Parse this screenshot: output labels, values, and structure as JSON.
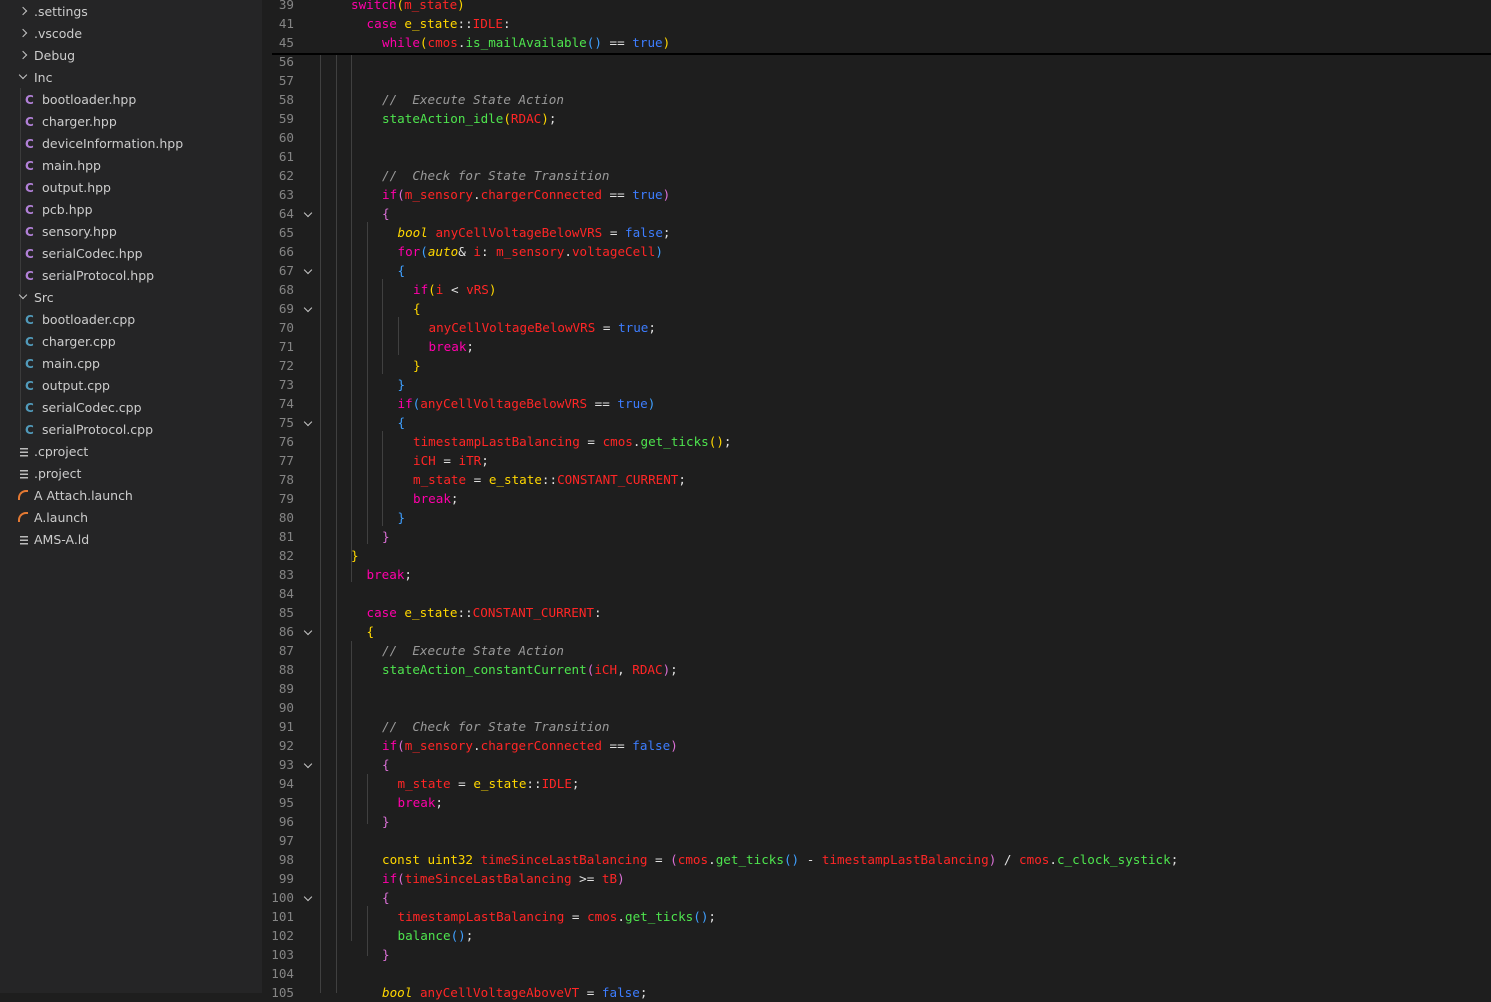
{
  "explorer": {
    "items": [
      {
        "label": ".settings",
        "kind": "folder-closed"
      },
      {
        "label": ".vscode",
        "kind": "folder-closed"
      },
      {
        "label": "Debug",
        "kind": "folder-closed"
      },
      {
        "label": "Inc",
        "kind": "folder-open"
      },
      {
        "label": "bootloader.hpp",
        "kind": "hpp"
      },
      {
        "label": "charger.hpp",
        "kind": "hpp"
      },
      {
        "label": "deviceInformation.hpp",
        "kind": "hpp"
      },
      {
        "label": "main.hpp",
        "kind": "hpp"
      },
      {
        "label": "output.hpp",
        "kind": "hpp"
      },
      {
        "label": "pcb.hpp",
        "kind": "hpp"
      },
      {
        "label": "sensory.hpp",
        "kind": "hpp"
      },
      {
        "label": "serialCodec.hpp",
        "kind": "hpp"
      },
      {
        "label": "serialProtocol.hpp",
        "kind": "hpp"
      },
      {
        "label": "Src",
        "kind": "folder-open"
      },
      {
        "label": "bootloader.cpp",
        "kind": "cpp"
      },
      {
        "label": "charger.cpp",
        "kind": "cpp"
      },
      {
        "label": "main.cpp",
        "kind": "cpp"
      },
      {
        "label": "output.cpp",
        "kind": "cpp"
      },
      {
        "label": "serialCodec.cpp",
        "kind": "cpp"
      },
      {
        "label": "serialProtocol.cpp",
        "kind": "cpp"
      },
      {
        "label": ".cproject",
        "kind": "text"
      },
      {
        "label": ".project",
        "kind": "text"
      },
      {
        "label": "A Attach.launch",
        "kind": "launch"
      },
      {
        "label": "A.launch",
        "kind": "launch"
      },
      {
        "label": "AMS-A.ld",
        "kind": "text"
      }
    ]
  },
  "editor": {
    "sticky_lines": [
      {
        "num": "39",
        "indent": 0,
        "tokens": [
          [
            "k",
            "switch"
          ],
          [
            "p1",
            "("
          ],
          [
            "v",
            "m_state"
          ],
          [
            "p1",
            ")"
          ]
        ]
      },
      {
        "num": "41",
        "indent": 1,
        "tokens": [
          [
            "k",
            "case "
          ],
          [
            "t",
            "e_state"
          ],
          [
            "o",
            "::"
          ],
          [
            "v",
            "IDLE"
          ],
          [
            "o",
            ":"
          ]
        ]
      },
      {
        "num": "45",
        "indent": 2,
        "tokens": [
          [
            "k",
            "while"
          ],
          [
            "p1",
            "("
          ],
          [
            "v",
            "cmos"
          ],
          [
            "o",
            "."
          ],
          [
            "f",
            "is_mailAvailable"
          ],
          [
            "p3",
            "()"
          ],
          [
            "o",
            " == "
          ],
          [
            "b",
            "true"
          ],
          [
            "p1",
            ")"
          ]
        ]
      }
    ],
    "lines": [
      {
        "num": "56",
        "fold": false,
        "indent": 0,
        "tokens": []
      },
      {
        "num": "57",
        "fold": false,
        "indent": 0,
        "tokens": []
      },
      {
        "num": "58",
        "fold": false,
        "indent": 2,
        "tokens": [
          [
            "c",
            "//  Execute State Action"
          ]
        ]
      },
      {
        "num": "59",
        "fold": false,
        "indent": 2,
        "tokens": [
          [
            "f",
            "stateAction_idle"
          ],
          [
            "p1",
            "("
          ],
          [
            "v",
            "RDAC"
          ],
          [
            "p1",
            ")"
          ],
          [
            "o",
            ";"
          ]
        ]
      },
      {
        "num": "60",
        "fold": false,
        "indent": 0,
        "tokens": []
      },
      {
        "num": "61",
        "fold": false,
        "indent": 0,
        "tokens": []
      },
      {
        "num": "62",
        "fold": false,
        "indent": 2,
        "tokens": [
          [
            "c",
            "//  Check for State Transition"
          ]
        ]
      },
      {
        "num": "63",
        "fold": false,
        "indent": 2,
        "tokens": [
          [
            "k",
            "if"
          ],
          [
            "p2",
            "("
          ],
          [
            "v",
            "m_sensory"
          ],
          [
            "o",
            "."
          ],
          [
            "v",
            "chargerConnected"
          ],
          [
            "o",
            " == "
          ],
          [
            "b",
            "true"
          ],
          [
            "p2",
            ")"
          ]
        ]
      },
      {
        "num": "64",
        "fold": true,
        "indent": 2,
        "tokens": [
          [
            "p2",
            "{"
          ]
        ]
      },
      {
        "num": "65",
        "fold": false,
        "indent": 3,
        "tokens": [
          [
            "tt",
            "bool"
          ],
          [
            "o",
            " "
          ],
          [
            "v",
            "anyCellVoltageBelowVRS"
          ],
          [
            "o",
            " = "
          ],
          [
            "b",
            "false"
          ],
          [
            "o",
            ";"
          ]
        ]
      },
      {
        "num": "66",
        "fold": false,
        "indent": 3,
        "tokens": [
          [
            "k",
            "for"
          ],
          [
            "p3",
            "("
          ],
          [
            "tt",
            "auto"
          ],
          [
            "o",
            "& "
          ],
          [
            "v",
            "i"
          ],
          [
            "o",
            ": "
          ],
          [
            "v",
            "m_sensory"
          ],
          [
            "o",
            "."
          ],
          [
            "v",
            "voltageCell"
          ],
          [
            "p3",
            ")"
          ]
        ]
      },
      {
        "num": "67",
        "fold": true,
        "indent": 3,
        "tokens": [
          [
            "p3",
            "{"
          ]
        ]
      },
      {
        "num": "68",
        "fold": false,
        "indent": 4,
        "tokens": [
          [
            "k",
            "if"
          ],
          [
            "p1",
            "("
          ],
          [
            "v",
            "i"
          ],
          [
            "o",
            " < "
          ],
          [
            "v",
            "vRS"
          ],
          [
            "p1",
            ")"
          ]
        ]
      },
      {
        "num": "69",
        "fold": true,
        "indent": 4,
        "tokens": [
          [
            "p1",
            "{"
          ]
        ]
      },
      {
        "num": "70",
        "fold": false,
        "indent": 5,
        "tokens": [
          [
            "v",
            "anyCellVoltageBelowVRS"
          ],
          [
            "o",
            " = "
          ],
          [
            "b",
            "true"
          ],
          [
            "o",
            ";"
          ]
        ]
      },
      {
        "num": "71",
        "fold": false,
        "indent": 5,
        "tokens": [
          [
            "k",
            "break"
          ],
          [
            "o",
            ";"
          ]
        ]
      },
      {
        "num": "72",
        "fold": false,
        "indent": 4,
        "tokens": [
          [
            "p1",
            "}"
          ]
        ]
      },
      {
        "num": "73",
        "fold": false,
        "indent": 3,
        "tokens": [
          [
            "p3",
            "}"
          ]
        ]
      },
      {
        "num": "74",
        "fold": false,
        "indent": 3,
        "tokens": [
          [
            "k",
            "if"
          ],
          [
            "p3",
            "("
          ],
          [
            "v",
            "anyCellVoltageBelowVRS"
          ],
          [
            "o",
            " == "
          ],
          [
            "b",
            "true"
          ],
          [
            "p3",
            ")"
          ]
        ]
      },
      {
        "num": "75",
        "fold": true,
        "indent": 3,
        "tokens": [
          [
            "p3",
            "{"
          ]
        ]
      },
      {
        "num": "76",
        "fold": false,
        "indent": 4,
        "tokens": [
          [
            "v",
            "timestampLastBalancing"
          ],
          [
            "o",
            " = "
          ],
          [
            "v",
            "cmos"
          ],
          [
            "o",
            "."
          ],
          [
            "f",
            "get_ticks"
          ],
          [
            "p1",
            "()"
          ],
          [
            "o",
            ";"
          ]
        ]
      },
      {
        "num": "77",
        "fold": false,
        "indent": 4,
        "tokens": [
          [
            "v",
            "iCH"
          ],
          [
            "o",
            " = "
          ],
          [
            "v",
            "iTR"
          ],
          [
            "o",
            ";"
          ]
        ]
      },
      {
        "num": "78",
        "fold": false,
        "indent": 4,
        "tokens": [
          [
            "v",
            "m_state"
          ],
          [
            "o",
            " = "
          ],
          [
            "t",
            "e_state"
          ],
          [
            "o",
            "::"
          ],
          [
            "v",
            "CONSTANT_CURRENT"
          ],
          [
            "o",
            ";"
          ]
        ]
      },
      {
        "num": "79",
        "fold": false,
        "indent": 4,
        "tokens": [
          [
            "k",
            "break"
          ],
          [
            "o",
            ";"
          ]
        ]
      },
      {
        "num": "80",
        "fold": false,
        "indent": 3,
        "tokens": [
          [
            "p3",
            "}"
          ]
        ]
      },
      {
        "num": "81",
        "fold": false,
        "indent": 2,
        "tokens": [
          [
            "p2",
            "}"
          ]
        ]
      },
      {
        "num": "82",
        "fold": false,
        "indent": 0,
        "tokens": [
          [
            "p1",
            "}"
          ]
        ]
      },
      {
        "num": "83",
        "fold": false,
        "indent": 1,
        "tokens": [
          [
            "k",
            "break"
          ],
          [
            "o",
            ";"
          ]
        ]
      },
      {
        "num": "84",
        "fold": false,
        "indent": 0,
        "tokens": []
      },
      {
        "num": "85",
        "fold": false,
        "indent": 1,
        "tokens": [
          [
            "k",
            "case "
          ],
          [
            "t",
            "e_state"
          ],
          [
            "o",
            "::"
          ],
          [
            "v",
            "CONSTANT_CURRENT"
          ],
          [
            "o",
            ":"
          ]
        ]
      },
      {
        "num": "86",
        "fold": true,
        "indent": 1,
        "tokens": [
          [
            "p1",
            "{"
          ]
        ]
      },
      {
        "num": "87",
        "fold": false,
        "indent": 2,
        "tokens": [
          [
            "c",
            "//  Execute State Action"
          ]
        ]
      },
      {
        "num": "88",
        "fold": false,
        "indent": 2,
        "tokens": [
          [
            "f",
            "stateAction_constantCurrent"
          ],
          [
            "p2",
            "("
          ],
          [
            "v",
            "iCH"
          ],
          [
            "o",
            ", "
          ],
          [
            "v",
            "RDAC"
          ],
          [
            "p2",
            ")"
          ],
          [
            "o",
            ";"
          ]
        ]
      },
      {
        "num": "89",
        "fold": false,
        "indent": 0,
        "tokens": []
      },
      {
        "num": "90",
        "fold": false,
        "indent": 0,
        "tokens": []
      },
      {
        "num": "91",
        "fold": false,
        "indent": 2,
        "tokens": [
          [
            "c",
            "//  Check for State Transition"
          ]
        ]
      },
      {
        "num": "92",
        "fold": false,
        "indent": 2,
        "tokens": [
          [
            "k",
            "if"
          ],
          [
            "p2",
            "("
          ],
          [
            "v",
            "m_sensory"
          ],
          [
            "o",
            "."
          ],
          [
            "v",
            "chargerConnected"
          ],
          [
            "o",
            " == "
          ],
          [
            "b",
            "false"
          ],
          [
            "p2",
            ")"
          ]
        ]
      },
      {
        "num": "93",
        "fold": true,
        "indent": 2,
        "tokens": [
          [
            "p2",
            "{"
          ]
        ]
      },
      {
        "num": "94",
        "fold": false,
        "indent": 3,
        "tokens": [
          [
            "v",
            "m_state"
          ],
          [
            "o",
            " = "
          ],
          [
            "t",
            "e_state"
          ],
          [
            "o",
            "::"
          ],
          [
            "v",
            "IDLE"
          ],
          [
            "o",
            ";"
          ]
        ]
      },
      {
        "num": "95",
        "fold": false,
        "indent": 3,
        "tokens": [
          [
            "k",
            "break"
          ],
          [
            "o",
            ";"
          ]
        ]
      },
      {
        "num": "96",
        "fold": false,
        "indent": 2,
        "tokens": [
          [
            "p2",
            "}"
          ]
        ]
      },
      {
        "num": "97",
        "fold": false,
        "indent": 0,
        "tokens": []
      },
      {
        "num": "98",
        "fold": false,
        "indent": 2,
        "tokens": [
          [
            "t",
            "const"
          ],
          [
            "o",
            " "
          ],
          [
            "t",
            "uint32"
          ],
          [
            "o",
            " "
          ],
          [
            "v",
            "timeSinceLastBalancing"
          ],
          [
            "o",
            " = "
          ],
          [
            "p2",
            "("
          ],
          [
            "v",
            "cmos"
          ],
          [
            "o",
            "."
          ],
          [
            "f",
            "get_ticks"
          ],
          [
            "p3",
            "()"
          ],
          [
            "o",
            " - "
          ],
          [
            "v",
            "timestampLastBalancing"
          ],
          [
            "p2",
            ")"
          ],
          [
            "o",
            " / "
          ],
          [
            "v",
            "cmos"
          ],
          [
            "o",
            "."
          ],
          [
            "f",
            "c_clock_systick"
          ],
          [
            "o",
            ";"
          ]
        ]
      },
      {
        "num": "99",
        "fold": false,
        "indent": 2,
        "tokens": [
          [
            "k",
            "if"
          ],
          [
            "p2",
            "("
          ],
          [
            "v",
            "timeSinceLastBalancing"
          ],
          [
            "o",
            " >= "
          ],
          [
            "v",
            "tB"
          ],
          [
            "p2",
            ")"
          ]
        ]
      },
      {
        "num": "100",
        "fold": true,
        "indent": 2,
        "tokens": [
          [
            "p2",
            "{"
          ]
        ]
      },
      {
        "num": "101",
        "fold": false,
        "indent": 3,
        "tokens": [
          [
            "v",
            "timestampLastBalancing"
          ],
          [
            "o",
            " = "
          ],
          [
            "v",
            "cmos"
          ],
          [
            "o",
            "."
          ],
          [
            "f",
            "get_ticks"
          ],
          [
            "p3",
            "()"
          ],
          [
            "o",
            ";"
          ]
        ]
      },
      {
        "num": "102",
        "fold": false,
        "indent": 3,
        "tokens": [
          [
            "f",
            "balance"
          ],
          [
            "p3",
            "()"
          ],
          [
            "o",
            ";"
          ]
        ]
      },
      {
        "num": "103",
        "fold": false,
        "indent": 2,
        "tokens": [
          [
            "p2",
            "}"
          ]
        ]
      },
      {
        "num": "104",
        "fold": false,
        "indent": 0,
        "tokens": []
      },
      {
        "num": "105",
        "fold": false,
        "indent": 2,
        "tokens": [
          [
            "tt",
            "bool"
          ],
          [
            "o",
            " "
          ],
          [
            "v",
            "anyCellVoltageAboveVT"
          ],
          [
            "o",
            " = "
          ],
          [
            "b",
            "false"
          ],
          [
            "o",
            ";"
          ]
        ]
      }
    ]
  }
}
